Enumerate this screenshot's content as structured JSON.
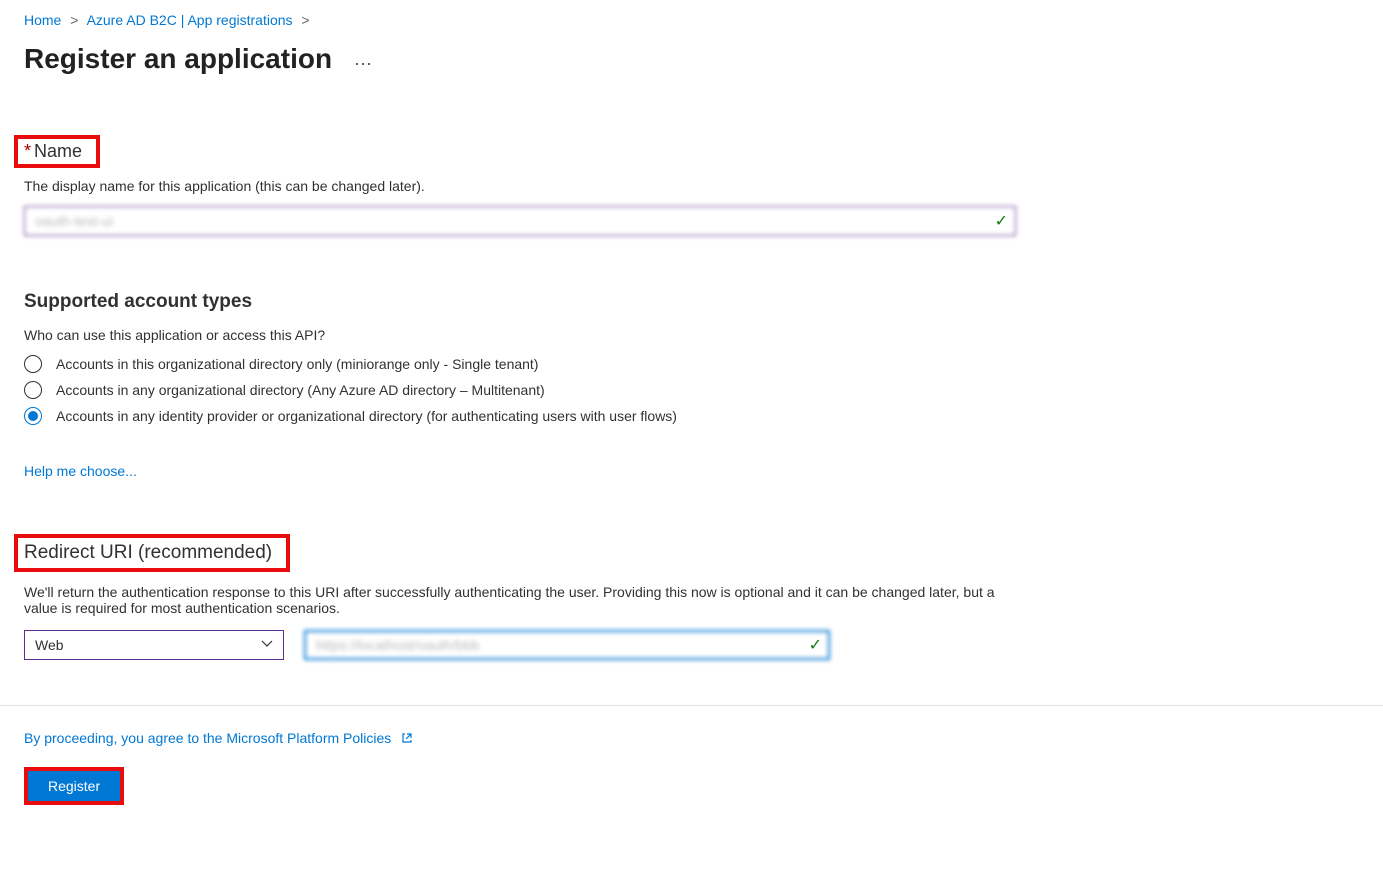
{
  "breadcrumb": {
    "home": "Home",
    "service": "Azure AD B2C | App registrations"
  },
  "page": {
    "title": "Register an application"
  },
  "name_section": {
    "label": "Name",
    "description": "The display name for this application (this can be changed later).",
    "value": "oauth-test-ui"
  },
  "accounts_section": {
    "heading": "Supported account types",
    "question": "Who can use this application or access this API?",
    "options": [
      {
        "label": "Accounts in this organizational directory only (miniorange only - Single tenant)",
        "selected": false
      },
      {
        "label": "Accounts in any organizational directory (Any Azure AD directory – Multitenant)",
        "selected": false
      },
      {
        "label": "Accounts in any identity provider or organizational directory (for authenticating users with user flows)",
        "selected": true
      }
    ],
    "help_link": "Help me choose..."
  },
  "redirect_section": {
    "heading": "Redirect URI (recommended)",
    "description": "We'll return the authentication response to this URI after successfully authenticating the user. Providing this now is optional and it can be changed later, but a value is required for most authentication scenarios.",
    "platform_selected": "Web",
    "uri_value": "https://localhost/oauth/bbb"
  },
  "footer": {
    "policy_text": "By proceeding, you agree to the Microsoft Platform Policies",
    "register_label": "Register"
  }
}
